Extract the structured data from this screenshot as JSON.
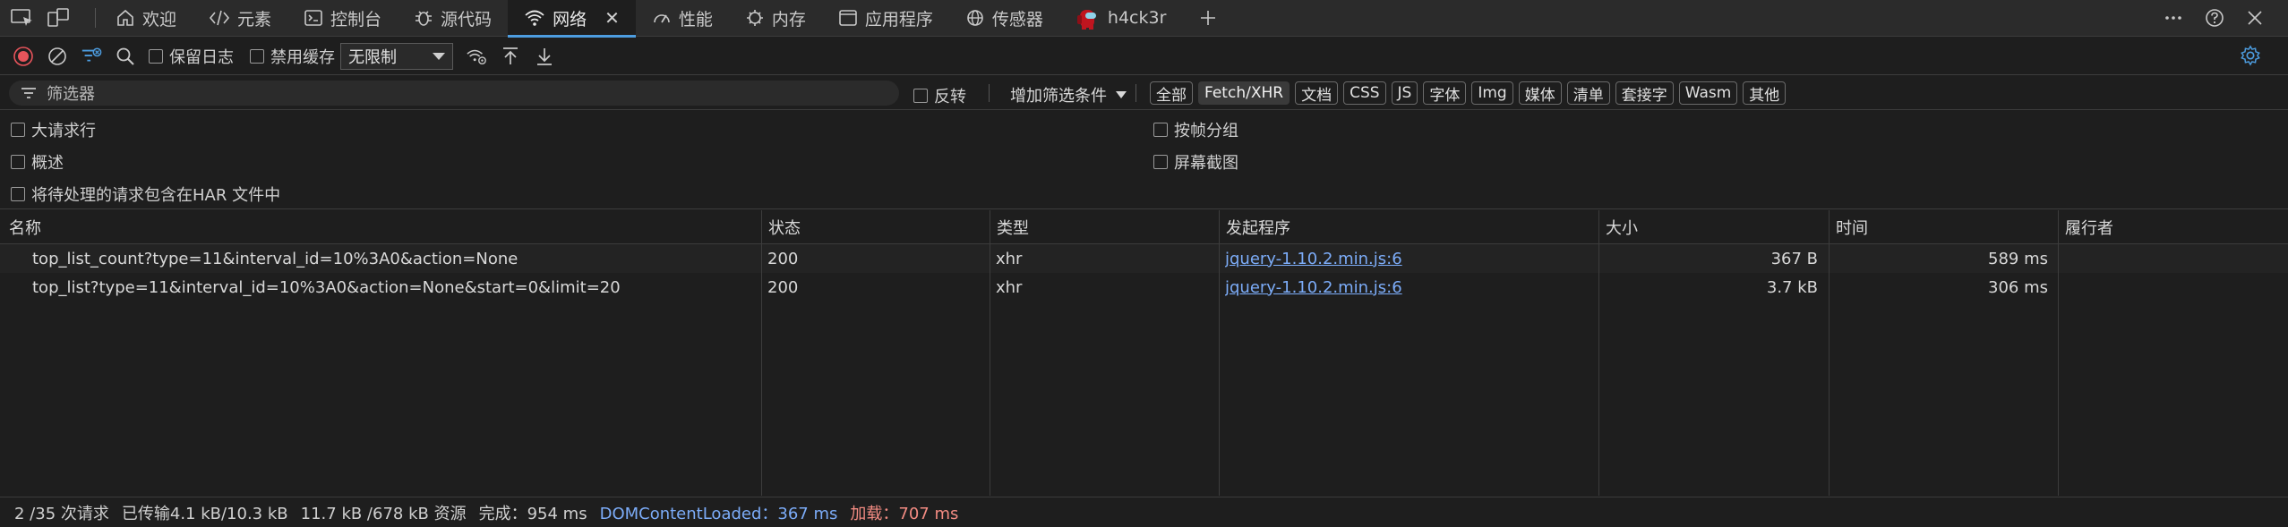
{
  "tabs": {
    "welcome": "欢迎",
    "elements": "元素",
    "console": "控制台",
    "sources": "源代码",
    "network": "网络",
    "performance": "性能",
    "memory": "内存",
    "application": "应用程序",
    "sensors": "传感器",
    "extension": "h4ck3r"
  },
  "toolbar": {
    "preserve_log": "保留日志",
    "disable_cache": "禁用缓存",
    "throttling": "无限制"
  },
  "filter": {
    "placeholder": "筛选器",
    "invert": "反转",
    "more_filters": "增加筛选条件",
    "types": [
      "全部",
      "Fetch/XHR",
      "文档",
      "CSS",
      "JS",
      "字体",
      "Img",
      "媒体",
      "清单",
      "套接字",
      "Wasm",
      "其他"
    ],
    "active_type": "Fetch/XHR"
  },
  "options": {
    "big_rows": "大请求行",
    "overview": "概述",
    "har": "将待处理的请求包含在HAR 文件中",
    "group_by_frame": "按帧分组",
    "screenshots": "屏幕截图"
  },
  "table": {
    "headers": {
      "name": "名称",
      "status": "状态",
      "type": "类型",
      "initiator": "发起程序",
      "size": "大小",
      "time": "时间",
      "fulfilled_by": "履行者"
    },
    "rows": [
      {
        "name": "top_list_count?type=11&interval_id=10%3A0&action=None",
        "status": "200",
        "type": "xhr",
        "initiator": "jquery-1.10.2.min.js:6",
        "size": "367 B",
        "time": "589 ms"
      },
      {
        "name": "top_list?type=11&interval_id=10%3A0&action=None&start=0&limit=20",
        "status": "200",
        "type": "xhr",
        "initiator": "jquery-1.10.2.min.js:6",
        "size": "3.7 kB",
        "time": "306 ms"
      }
    ]
  },
  "status": {
    "requests": "2 /35 次请求",
    "transferred": "已传输4.1 kB/10.3 kB",
    "resources": "11.7 kB /678 kB 资源",
    "finish": "完成：954 ms",
    "dcl": "DOMContentLoaded：367 ms",
    "load": "加载：707 ms"
  },
  "colors": {
    "accent": "#4d9de0",
    "link": "#7cacf8",
    "load": "#f28b82",
    "record": "#e8545b"
  }
}
